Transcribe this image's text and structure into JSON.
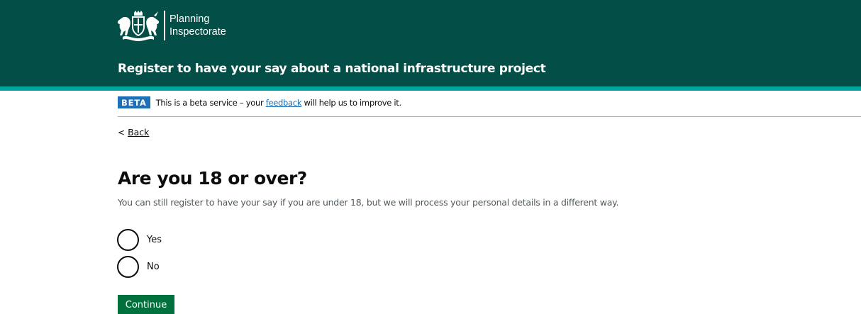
{
  "header": {
    "org_line1": "Planning",
    "org_line2": "Inspectorate",
    "service_name": "Register to have your say about a national infrastructure project",
    "crest_icon": "royal-coat-of-arms-icon"
  },
  "phase_banner": {
    "tag": "BETA",
    "text_before": "This is a beta service – your ",
    "link_text": "feedback",
    "text_after": " will help us to improve it."
  },
  "back_link": {
    "chevron": "<",
    "label": "Back"
  },
  "question": {
    "title": "Are you 18 or over?",
    "hint": "You can still register to have your say if you are under 18, but we will process your personal details in a different way.",
    "options": [
      {
        "label": "Yes",
        "selected": false
      },
      {
        "label": "No",
        "selected": false
      }
    ]
  },
  "actions": {
    "continue_label": "Continue"
  },
  "colors": {
    "header_bg": "#034e46",
    "header_stripe": "#00a5a0",
    "beta_tag": "#1d70b8",
    "link": "#1d70b8",
    "button_bg": "#00703c",
    "hint_text": "#505a5f"
  }
}
